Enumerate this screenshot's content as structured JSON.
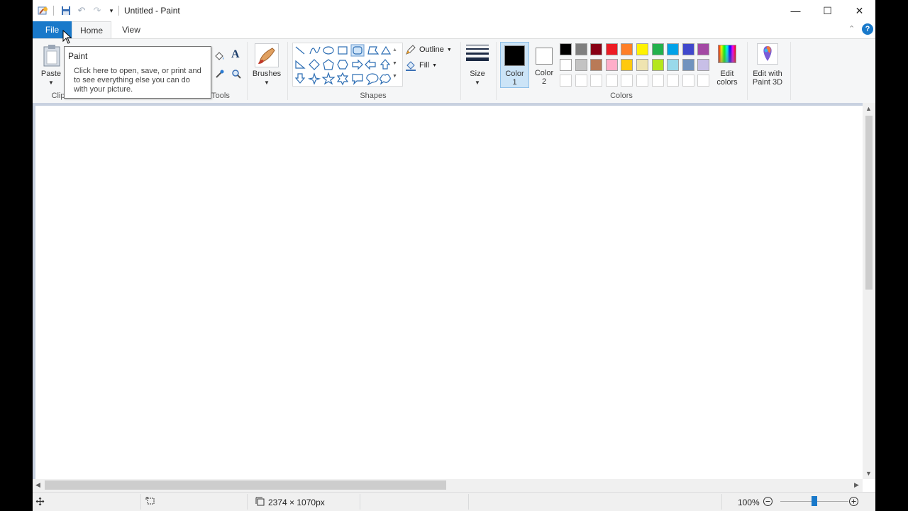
{
  "window": {
    "title": "Untitled - Paint",
    "controls": {
      "minimize": "—",
      "maximize": "☐",
      "close": "✕"
    }
  },
  "ribbon": {
    "tabs": {
      "file": "File",
      "home": "Home",
      "view": "View"
    },
    "clipboard": {
      "paste_label": "Paste",
      "group_label_partial": "Clip"
    },
    "tools": {
      "group_label_partial": "Tools",
      "text_tool_glyph": "A"
    },
    "brushes": {
      "label": "Brushes"
    },
    "shapes": {
      "group_label": "Shapes",
      "outline_label": "Outline",
      "fill_label": "Fill"
    },
    "size": {
      "label": "Size"
    },
    "colors": {
      "group_label": "Colors",
      "color1": {
        "line1": "Color",
        "line2": "1",
        "value": "#000000"
      },
      "color2": {
        "line1": "Color",
        "line2": "2",
        "value": "#ffffff"
      },
      "edit_colors": {
        "line1": "Edit",
        "line2": "colors"
      },
      "palette_row1": [
        "#000000",
        "#7f7f7f",
        "#880015",
        "#ed1c24",
        "#ff7f27",
        "#fff200",
        "#22b14c",
        "#00a2e8",
        "#3f48cc",
        "#a349a4"
      ],
      "palette_row2": [
        "#ffffff",
        "#c3c3c3",
        "#b97a57",
        "#ffaec9",
        "#ffc90e",
        "#efe4b0",
        "#b5e61d",
        "#99d9ea",
        "#7092be",
        "#c8bfe7"
      ]
    },
    "paint3d": {
      "line1": "Edit with",
      "line2": "Paint 3D"
    }
  },
  "tooltip": {
    "title": "Paint",
    "body": "Click here to open, save, or print and to see everything else you can do with your picture."
  },
  "status": {
    "dimensions": "2374 × 1070px",
    "zoom": "100%",
    "zoom_level": 0.5
  }
}
